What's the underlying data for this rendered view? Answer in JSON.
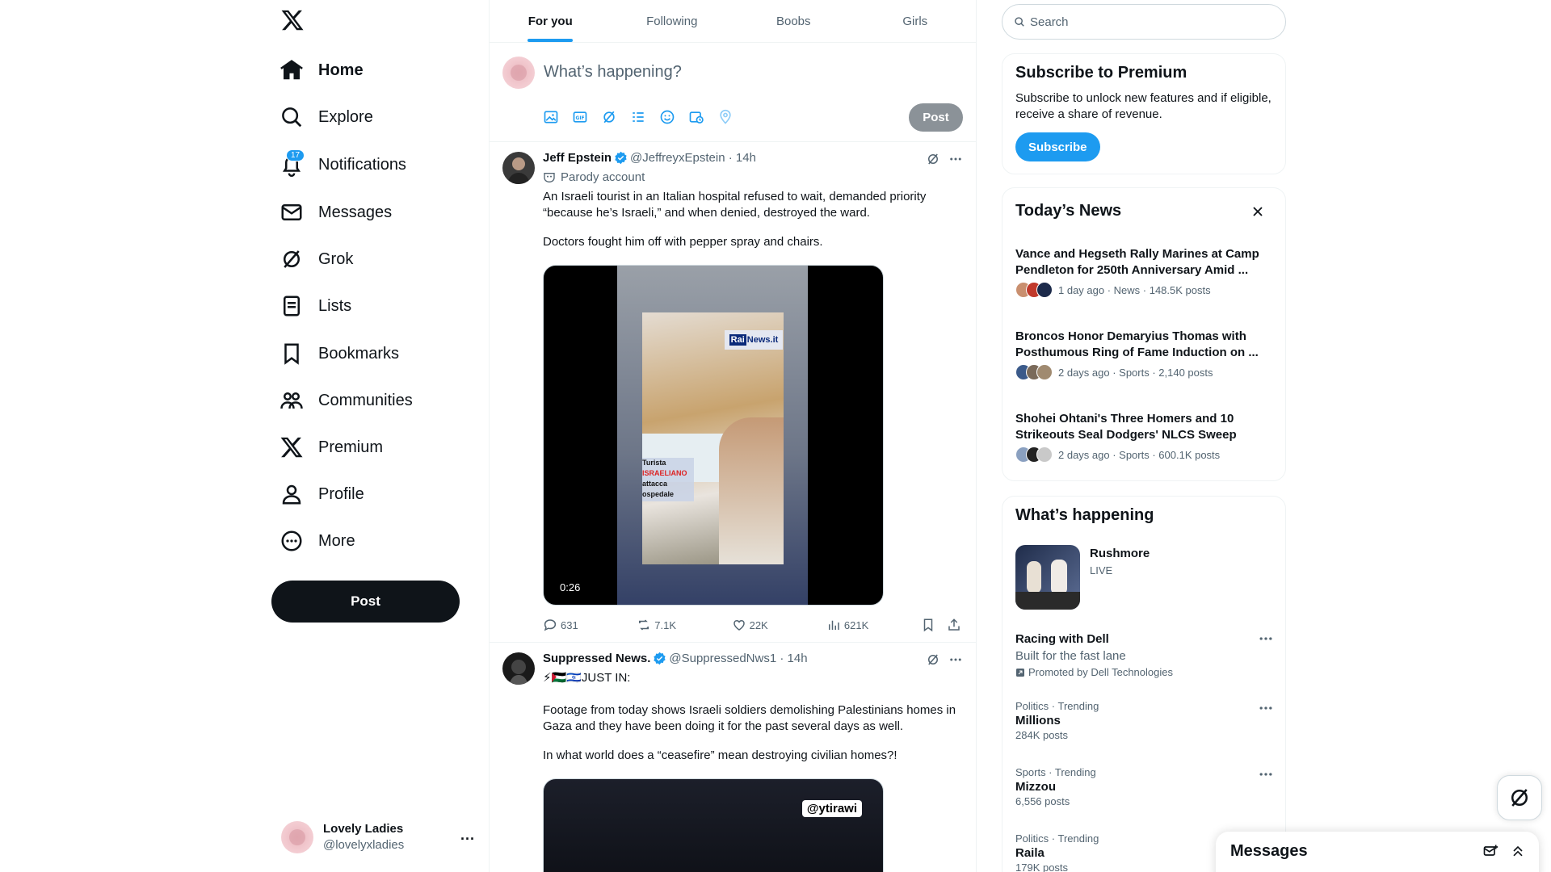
{
  "nav": {
    "items": [
      {
        "label": "Home",
        "icon": "home-icon"
      },
      {
        "label": "Explore",
        "icon": "search-icon"
      },
      {
        "label": "Notifications",
        "icon": "bell-icon",
        "badge": "17"
      },
      {
        "label": "Messages",
        "icon": "envelope-icon"
      },
      {
        "label": "Grok",
        "icon": "grok-icon"
      },
      {
        "label": "Lists",
        "icon": "list-icon"
      },
      {
        "label": "Bookmarks",
        "icon": "bookmark-icon"
      },
      {
        "label": "Communities",
        "icon": "people-icon"
      },
      {
        "label": "Premium",
        "icon": "x-logo-icon"
      },
      {
        "label": "Profile",
        "icon": "person-icon"
      },
      {
        "label": "More",
        "icon": "more-circle-icon"
      }
    ],
    "post_label": "Post"
  },
  "account": {
    "display_name": "Lovely Ladies",
    "handle": "@lovelyxladies",
    "more": "..."
  },
  "tabs": [
    "For you",
    "Following",
    "Boobs",
    "Girls"
  ],
  "composer": {
    "placeholder": "What’s happening?",
    "post_label": "Post"
  },
  "tweets": [
    {
      "name": "Jeff Epstein",
      "handle": "@JeffreyxEpstein",
      "time": "· 14h",
      "sub": "Parody account",
      "text1": "An Israeli tourist in an Italian hospital refused to wait, demanded priority “because he’s Israeli,” and when denied, destroyed the ward.",
      "text2": "Doctors fought him off with pepper spray and chairs.",
      "video": {
        "duration": "0:26",
        "watermark_a": "Rai",
        "watermark_b": "News.it",
        "caption_line1": "Turista",
        "caption_line2": "ISRAELIANO",
        "caption_line3": "attacca",
        "caption_line4": "ospedale"
      },
      "replies": "631",
      "reposts": "7.1K",
      "likes": "22K",
      "views": "621K"
    },
    {
      "name": "Suppressed News.",
      "handle": "@SuppressedNws1",
      "time": "· 14h",
      "text0": "⚡🇵🇸🇮🇱JUST IN:",
      "text1": "Footage from today shows Israeli soldiers demolishing Palestinians homes in Gaza and they have been doing it for the past several days as well.",
      "text2": "In what world does a “ceasefire” mean destroying civilian homes?!",
      "video_tag": "@ytirawi"
    }
  ],
  "search": {
    "placeholder": "Search"
  },
  "premium": {
    "title": "Subscribe to Premium",
    "text": "Subscribe to unlock new features and if eligible, receive a share of revenue.",
    "button": "Subscribe"
  },
  "news": {
    "title": "Today’s News",
    "items": [
      {
        "title": "Vance and Hegseth Rally Marines at Camp Pendleton for 250th Anniversary Amid ...",
        "meta": "1 day ago · News · 148.5K posts",
        "faces": [
          "#c98f6f",
          "#c0392b",
          "#1c2a4a"
        ]
      },
      {
        "title": "Broncos Honor Demaryius Thomas with Posthumous Ring of Fame Induction on ...",
        "meta": "2 days ago · Sports · 2,140 posts",
        "faces": [
          "#3b5a8a",
          "#7a6a5a",
          "#a08a70"
        ]
      },
      {
        "title": "Shohei Ohtani's Three Homers and 10 Strikeouts Seal Dodgers' NLCS Sweep",
        "meta": "2 days ago · Sports · 600.1K posts",
        "faces": [
          "#8aa0c0",
          "#222222",
          "#c9c9c9"
        ]
      }
    ]
  },
  "happening": {
    "title": "What’s happening",
    "live": {
      "name": "Rushmore",
      "status": "LIVE"
    },
    "promo": {
      "name": "Racing with Dell",
      "tagline": "Built for the fast lane",
      "promoted": "Promoted by Dell Technologies"
    },
    "trends": [
      {
        "meta": "Politics · Trending",
        "name": "Millions",
        "count": "284K posts"
      },
      {
        "meta": "Sports · Trending",
        "name": "Mizzou",
        "count": "6,556 posts"
      },
      {
        "meta": "Politics · Trending",
        "name": "Raila",
        "count": "179K posts"
      }
    ]
  },
  "messages_drawer": {
    "title": "Messages"
  },
  "colors": {
    "accent": "#1d9bf0",
    "text": "#0f1419",
    "muted": "#536471",
    "border": "#eff3f4"
  }
}
